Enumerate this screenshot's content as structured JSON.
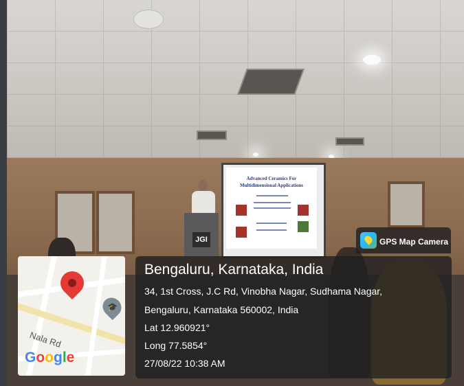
{
  "slide": {
    "title_line1": "Advanced Ceramics For",
    "title_line2": "Multidimensional Applications"
  },
  "podium": {
    "logo": "JGI"
  },
  "map": {
    "road_label": "Nala Rd",
    "brand": {
      "g1": "G",
      "o1": "o",
      "o2": "o",
      "g2": "g",
      "l": "l",
      "e": "e"
    }
  },
  "badge": {
    "label": "GPS Map Camera",
    "icon": "gps-map-camera-icon"
  },
  "location": {
    "place": "Bengaluru, Karnataka, India",
    "address_line1": "34, 1st Cross, J.C Rd, Vinobha Nagar, Sudhama Nagar,",
    "address_line2": "Bengaluru, Karnataka 560002, India",
    "lat": "Lat 12.960921°",
    "long": "Long 77.5854°",
    "datetime": "27/08/22 10:38 AM"
  }
}
